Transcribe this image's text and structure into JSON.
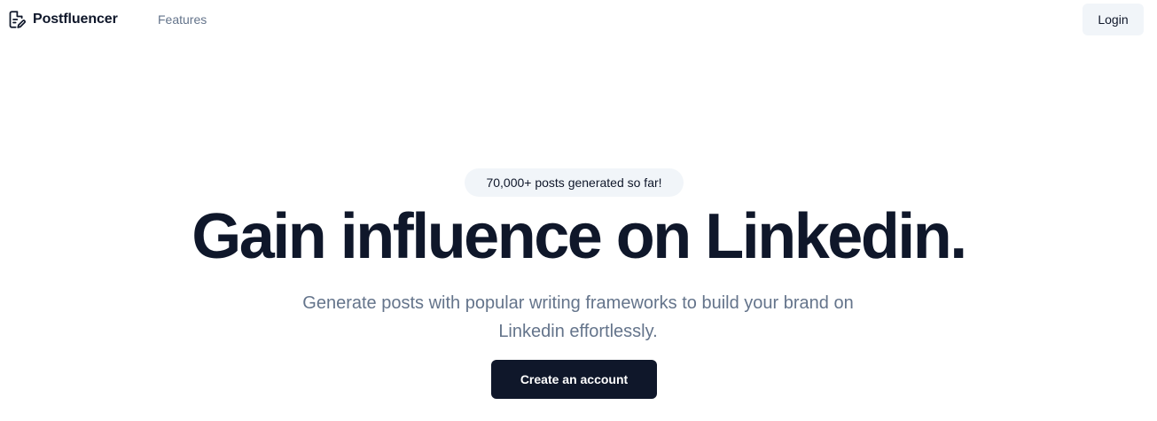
{
  "nav": {
    "brand_icon": "pen-document-icon",
    "brand_name": "Postfluencer",
    "features_label": "Features",
    "login_label": "Login"
  },
  "hero": {
    "badge": "70,000+ posts generated so far!",
    "headline": "Gain influence on Linkedin.",
    "subheadline": "Generate posts with popular writing frameworks to build your brand on Linkedin effortlessly.",
    "cta_label": "Create an account"
  },
  "colors": {
    "primary": "#0f172a",
    "muted_text": "#64748b",
    "light_bg": "#f1f5f9",
    "background": "#ffffff"
  }
}
